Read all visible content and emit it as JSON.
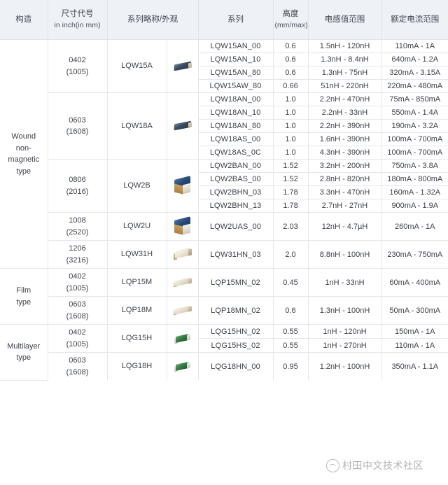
{
  "table": {
    "columns": [
      {
        "key": "structure",
        "label": "构造",
        "sub": ""
      },
      {
        "key": "size_code",
        "label": "尺寸代号",
        "sub": "in inch(in mm)"
      },
      {
        "key": "series_appearance",
        "label": "系列略称/外观",
        "sub": ""
      },
      {
        "key": "part_series",
        "label": "系列",
        "sub": ""
      },
      {
        "key": "height",
        "label": "高度",
        "sub": "(mm/max)"
      },
      {
        "key": "inductance_range",
        "label": "电感值范围",
        "sub": ""
      },
      {
        "key": "current_range",
        "label": "额定电流范围",
        "sub": ""
      }
    ],
    "structures": [
      {
        "name": "Wound\nnon-magnetic\ntype",
        "name_lines": [
          "Wound",
          "non-magnetic",
          "type"
        ],
        "groups": [
          {
            "size_inch": "0402",
            "size_mm": "(1005)",
            "series": "LQW15A",
            "appearance": "wound-small-navy-chip",
            "rows": [
              {
                "part": "LQW15AN_00",
                "height": "0.6",
                "inductance": "1.5nH - 120nH",
                "current": "110mA - 1A"
              },
              {
                "part": "LQW15AN_10",
                "height": "0.6",
                "inductance": "1.3nH - 8.4nH",
                "current": "640mA - 1.2A"
              },
              {
                "part": "LQW15AN_80",
                "height": "0.6",
                "inductance": "1.3nH - 75nH",
                "current": "320mA - 3.15A"
              },
              {
                "part": "LQW15AW_80",
                "height": "0.66",
                "inductance": "51nH - 220nH",
                "current": "220mA - 480mA"
              }
            ]
          },
          {
            "size_inch": "0603",
            "size_mm": "(1608)",
            "series": "LQW18A",
            "appearance": "wound-small-navy-chip",
            "rows": [
              {
                "part": "LQW18AN_00",
                "height": "1.0",
                "inductance": "2.2nH - 470nH",
                "current": "75mA - 850mA"
              },
              {
                "part": "LQW18AN_10",
                "height": "1.0",
                "inductance": "2.2nH - 33nH",
                "current": "550mA - 1.4A"
              },
              {
                "part": "LQW18AN_80",
                "height": "1.0",
                "inductance": "2.2nH - 390nH",
                "current": "190mA - 3.2A"
              },
              {
                "part": "LQW18AS_00",
                "height": "1.0",
                "inductance": "1.6nH - 390nH",
                "current": "100mA - 700mA"
              },
              {
                "part": "LQW18AS_0C",
                "height": "1.0",
                "inductance": "4.3nH - 390nH",
                "current": "100mA - 700mA"
              }
            ]
          },
          {
            "size_inch": "0806",
            "size_mm": "(2016)",
            "series": "LQW2B",
            "appearance": "wound-large-blue-chip",
            "rows": [
              {
                "part": "LQW2BAN_00",
                "height": "1.52",
                "inductance": "3.2nH - 200nH",
                "current": "750mA - 3.8A"
              },
              {
                "part": "LQW2BAS_00",
                "height": "1.52",
                "inductance": "2.8nH - 820nH",
                "current": "180mA - 800mA"
              },
              {
                "part": "LQW2BHN_03",
                "height": "1.78",
                "inductance": "3.3nH - 470nH",
                "current": "160mA - 1.32A"
              },
              {
                "part": "LQW2BHN_13",
                "height": "1.78",
                "inductance": "2.7nH - 27nH",
                "current": "900mA - 1.9A"
              }
            ]
          },
          {
            "size_inch": "1008",
            "size_mm": "(2520)",
            "series": "LQW2U",
            "appearance": "wound-large-blue-chip",
            "rows": [
              {
                "part": "LQW2UAS_00",
                "height": "2.03",
                "inductance": "12nH - 4.7µH",
                "current": "260mA - 1A"
              }
            ]
          },
          {
            "size_inch": "1206",
            "size_mm": "(3216)",
            "series": "LQW31H",
            "appearance": "film-cream-chip-tall",
            "rows": [
              {
                "part": "LQW31HN_03",
                "height": "2.0",
                "inductance": "8.8nH - 100nH",
                "current": "230mA - 750mA"
              }
            ]
          }
        ]
      },
      {
        "name": "Film\ntype",
        "name_lines": [
          "Film",
          "type"
        ],
        "groups": [
          {
            "size_inch": "0402",
            "size_mm": "(1005)",
            "series": "LQP15M",
            "appearance": "film-cream-chip",
            "rows": [
              {
                "part": "LQP15MN_02",
                "height": "0.45",
                "inductance": "1nH - 33nH",
                "current": "60mA - 400mA"
              }
            ]
          },
          {
            "size_inch": "0603",
            "size_mm": "(1608)",
            "series": "LQP18M",
            "appearance": "film-cream-chip",
            "rows": [
              {
                "part": "LQP18MN_02",
                "height": "0.6",
                "inductance": "1.3nH - 100nH",
                "current": "50mA - 300mA"
              }
            ]
          }
        ]
      },
      {
        "name": "Multilayer\ntype",
        "name_lines": [
          "Multilayer",
          "type"
        ],
        "groups": [
          {
            "size_inch": "0402",
            "size_mm": "(1005)",
            "series": "LQG15H",
            "appearance": "multilayer-green-chip",
            "rows": [
              {
                "part": "LQG15HN_02",
                "height": "0.55",
                "inductance": "1nH - 120nH",
                "current": "150mA - 1A"
              },
              {
                "part": "LQG15HS_02",
                "height": "0.55",
                "inductance": "1nH - 270nH",
                "current": "110mA - 1A"
              }
            ]
          },
          {
            "size_inch": "0603",
            "size_mm": "(1608)",
            "series": "LQG18H",
            "appearance": "multilayer-green-chip",
            "rows": [
              {
                "part": "LQG18HN_00",
                "height": "0.95",
                "inductance": "1.2nH - 100nH",
                "current": "350mA - 1.1A"
              }
            ]
          }
        ]
      }
    ]
  },
  "watermark": {
    "text": "村田中文技术社区",
    "logo": "murata-circle-logo"
  },
  "colors": {
    "header_bg": "#eef1f6",
    "border": "#e3e6eb",
    "text": "#3c4149"
  }
}
